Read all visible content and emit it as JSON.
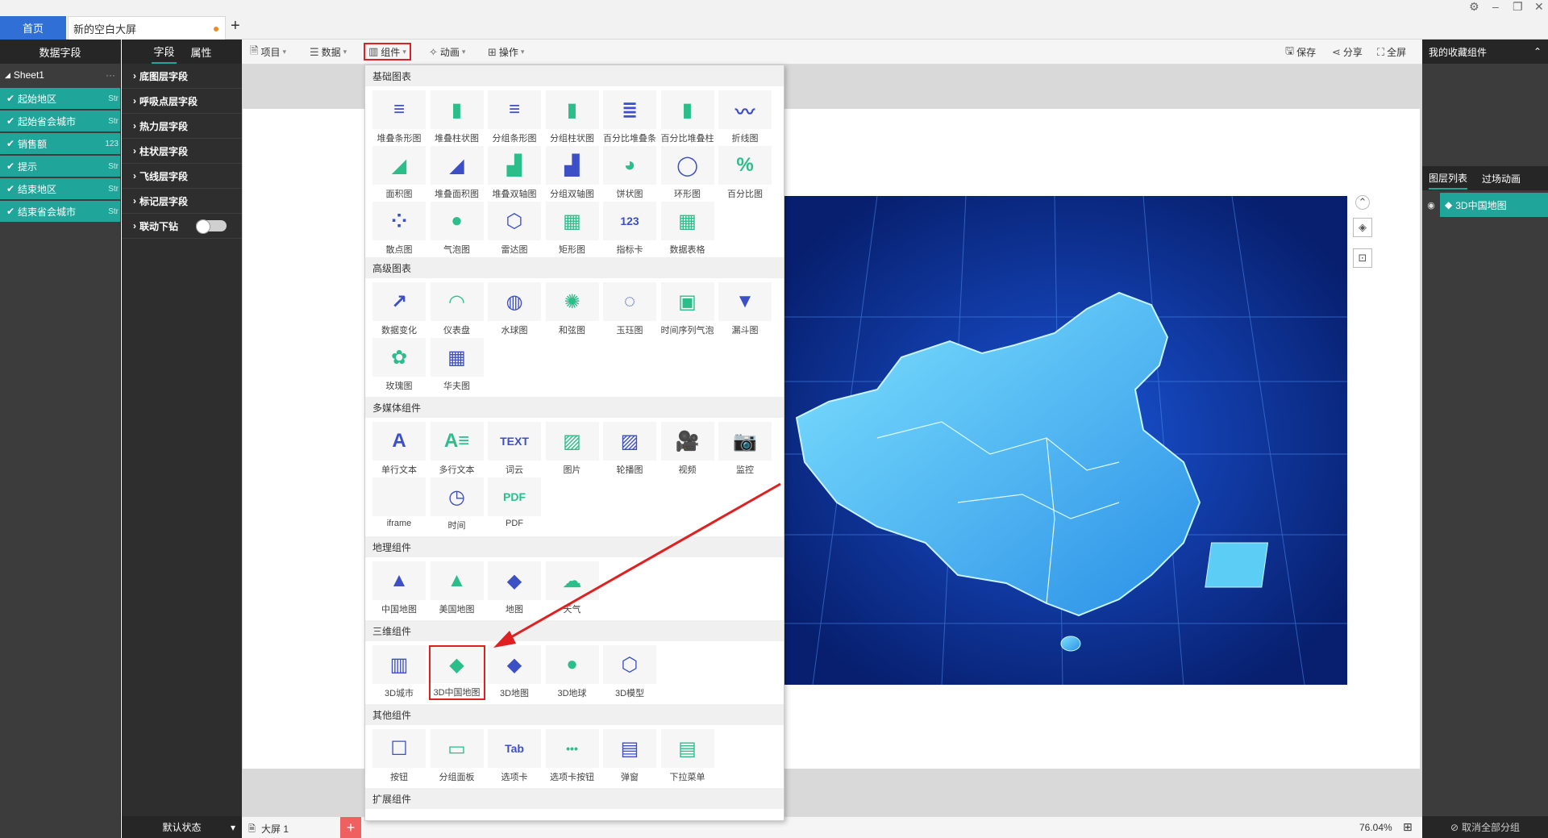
{
  "tabs": {
    "home": "首页",
    "doc": "新的空白大屏"
  },
  "left_panel": {
    "title": "数据字段",
    "sheet": "Sheet1",
    "fields": [
      {
        "label": "起始地区",
        "type": "Str"
      },
      {
        "label": "起始省会城市",
        "type": "Str"
      },
      {
        "label": "销售额",
        "type": "123"
      },
      {
        "label": "提示",
        "type": "Str"
      },
      {
        "label": "结束地区",
        "type": "Str"
      },
      {
        "label": "结束省会城市",
        "type": "Str"
      }
    ]
  },
  "field_panel": {
    "tab_field": "字段",
    "tab_attr": "属性",
    "rows": [
      "底图层字段",
      "呼吸点层字段",
      "热力层字段",
      "柱状层字段",
      "飞线层字段",
      "标记层字段",
      "联动下钻"
    ],
    "state": "默认状态"
  },
  "toolbar": {
    "project": "项目",
    "data": "数据",
    "component": "组件",
    "animation": "动画",
    "operation": "操作",
    "save": "保存",
    "share": "分享",
    "fullscreen": "全屏"
  },
  "right_panel": {
    "title": "我的收藏组件",
    "tab_layers": "图层列表",
    "tab_transition": "过场动画",
    "layer_item": "3D中国地图",
    "ungroup": "取消全部分组"
  },
  "page_bar": {
    "page": "大屏 1",
    "zoom": "76.04%"
  },
  "component_menu": {
    "sections": [
      {
        "title": "基础图表",
        "items": [
          "堆叠条形图",
          "堆叠柱状图",
          "分组条形图",
          "分组柱状图",
          "百分比堆叠条",
          "百分比堆叠柱",
          "折线图",
          "面积图",
          "堆叠面积图",
          "堆叠双轴图",
          "分组双轴图",
          "饼状图",
          "环形图",
          "百分比图",
          "散点图",
          "气泡图",
          "雷达图",
          "矩形图",
          "指标卡",
          "数据表格"
        ]
      },
      {
        "title": "高级图表",
        "items": [
          "数据变化",
          "仪表盘",
          "水球图",
          "和弦图",
          "玉珏图",
          "时间序列气泡",
          "漏斗图",
          "玫瑰图",
          "华夫图"
        ]
      },
      {
        "title": "多媒体组件",
        "items": [
          "单行文本",
          "多行文本",
          "词云",
          "图片",
          "轮播图",
          "视频",
          "监控",
          "iframe",
          "时间",
          "PDF"
        ]
      },
      {
        "title": "地理组件",
        "items": [
          "中国地图",
          "美国地图",
          "地图",
          "天气"
        ]
      },
      {
        "title": "三维组件",
        "items": [
          "3D城市",
          "3D中国地图",
          "3D地图",
          "3D地球",
          "3D模型"
        ]
      },
      {
        "title": "其他组件",
        "items": [
          "按钮",
          "分组面板",
          "选项卡",
          "选项卡按钮",
          "弹窗",
          "下拉菜单"
        ]
      },
      {
        "title": "扩展组件",
        "items": []
      }
    ],
    "icon_glyphs": {
      "s0": [
        "≡",
        "▮",
        "≡",
        "▮",
        "≣",
        "▮",
        "〰",
        "◢",
        "◢",
        "▟",
        "▟",
        "◕",
        "◯",
        "%",
        "⁘",
        "●",
        "⬡",
        "▦",
        "123",
        "▦"
      ],
      "s1": [
        "↗",
        "◠",
        "◍",
        "✺",
        "◌",
        "▣",
        "▼",
        "✿",
        "▦"
      ],
      "s2": [
        "A",
        "A≡",
        "TEXT",
        "▨",
        "▨",
        "🎥",
        "📷",
        "</>",
        "◷",
        "PDF"
      ],
      "s3": [
        "▲",
        "▲",
        "◆",
        "☁"
      ],
      "s4": [
        "▥",
        "◆",
        "◆",
        "●",
        "⬡"
      ],
      "s5": [
        "☐",
        "▭",
        "Tab",
        "•••",
        "▤",
        "▤"
      ]
    },
    "icon_colors": {
      "primary": "#3d4fc7",
      "accent": "#2bbd8a",
      "yellow": "#f5c518"
    }
  },
  "colors": {
    "teal": "#20a59b",
    "home_tab": "#2f6fd6",
    "highlight": "#e02020",
    "map_bg": "#0a2c8c"
  }
}
